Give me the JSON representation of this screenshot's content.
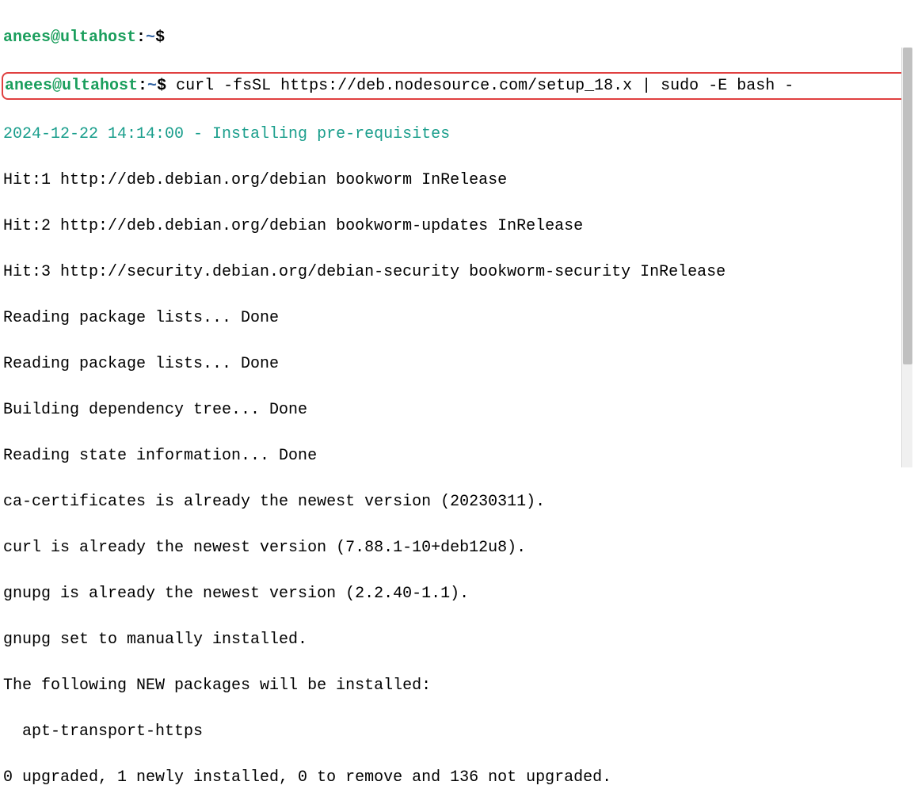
{
  "prompt1": {
    "user": "anees@ultahost",
    "colon": ":",
    "path": "~",
    "dollar": "$"
  },
  "prompt2": {
    "user": "anees@ultahost",
    "colon": ":",
    "path": "~",
    "dollar": "$",
    "command": " curl -fsSL https://deb.nodesource.com/setup_18.x | sudo -E bash -"
  },
  "status": "2024-12-22 14:14:00 - Installing pre-requisites",
  "output": [
    "Hit:1 http://deb.debian.org/debian bookworm InRelease",
    "Hit:2 http://deb.debian.org/debian bookworm-updates InRelease",
    "Hit:3 http://security.debian.org/debian-security bookworm-security InRelease",
    "Reading package lists... Done",
    "Reading package lists... Done",
    "Building dependency tree... Done",
    "Reading state information... Done",
    "ca-certificates is already the newest version (20230311).",
    "curl is already the newest version (7.88.1-10+deb12u8).",
    "gnupg is already the newest version (2.2.40-1.1).",
    "gnupg set to manually installed.",
    "The following NEW packages will be installed:",
    "  apt-transport-https",
    "0 upgraded, 1 newly installed, 0 to remove and 136 not upgraded."
  ]
}
